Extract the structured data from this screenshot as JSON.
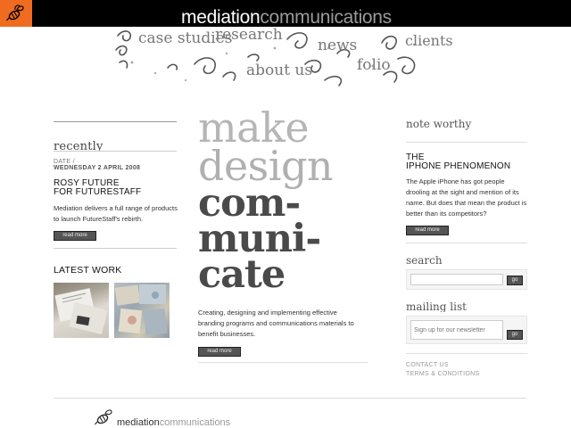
{
  "header": {
    "brand_bold": "mediation",
    "brand_light": "communications",
    "logo_icon": "bee-icon",
    "accent_color": "#ef6b1f"
  },
  "nav": {
    "items": [
      {
        "label": "case studies"
      },
      {
        "label": "research"
      },
      {
        "label": "news"
      },
      {
        "label": "clients"
      },
      {
        "label": "about us"
      },
      {
        "label": "folio"
      }
    ]
  },
  "left": {
    "recently_heading": "recently",
    "date_label": "DATE /",
    "date_value": "WEDNESDAY 2 APRIL 2008",
    "news_title_1": "ROSY FUTURE",
    "news_title_2": "FOR FUTURESTAFF",
    "news_text": "Mediation delivers a full range of products to launch FutureStaff's rebirth.",
    "read_more": "read more",
    "latest_work_heading": "LATEST WORK"
  },
  "center": {
    "hero_line1": "make",
    "hero_line2": "design",
    "hero_line3": "com-",
    "hero_line4": "muni-",
    "hero_line5": "cate",
    "tagline": "Creating, designing and implementing effective branding programs and communications materials to benefit businesses.",
    "read_more": "read more"
  },
  "right": {
    "note_worthy_heading": "note worthy",
    "iphone_title_1": "THE",
    "iphone_title_2": "IPHONE PHENOMENON",
    "iphone_text": "The Apple iPhone has got people drooling at the sight and mention of its name. But does that mean the product is better than its competitors?",
    "read_more": "read more",
    "search_heading": "search",
    "search_value": "",
    "go_label": "go",
    "mailing_heading": "mailing list",
    "mailing_placeholder": "Sign up for our newsletter",
    "contact_link": "CONTACT US",
    "terms_link": "TERMS & CONDITIONS"
  },
  "footer": {
    "brand_bold": "mediation",
    "brand_light": "communications"
  }
}
